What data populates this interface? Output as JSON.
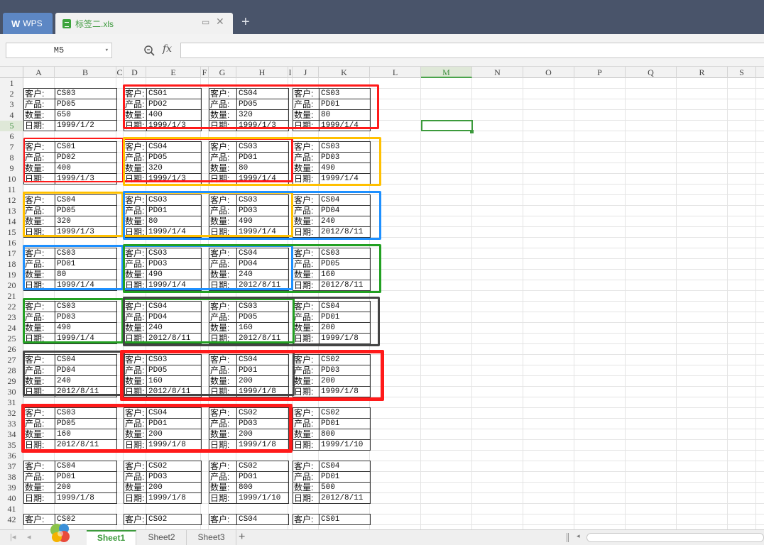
{
  "tabs": {
    "app_label": "WPS",
    "file_label": "标签二.xls"
  },
  "formula_bar": {
    "name_box": "M5",
    "fx_label": "fx",
    "formula": ""
  },
  "columns": [
    "A",
    "B",
    "C",
    "D",
    "E",
    "F",
    "G",
    "H",
    "I",
    "J",
    "K",
    "L",
    "M",
    "N",
    "O",
    "P",
    "Q",
    "R",
    "S"
  ],
  "active_column": "M",
  "rows": [
    "1",
    "2",
    "3",
    "4",
    "5",
    "6",
    "7",
    "8",
    "9",
    "10",
    "11",
    "12",
    "13",
    "14",
    "15",
    "16",
    "17",
    "18",
    "19",
    "20",
    "21",
    "22",
    "23",
    "24",
    "25",
    "26",
    "27",
    "28",
    "29",
    "30",
    "31",
    "32",
    "33",
    "34",
    "35",
    "36",
    "37",
    "38",
    "39",
    "40",
    "41",
    "42"
  ],
  "active_row": "5",
  "labels": [
    "客户:",
    "产品:",
    "数量:",
    "日期:"
  ],
  "cards": [
    [
      "CS03",
      "PD05",
      "650",
      "1999/1/2"
    ],
    [
      "CS01",
      "PD02",
      "400",
      "1999/1/3"
    ],
    [
      "CS04",
      "PD05",
      "320",
      "1999/1/3"
    ],
    [
      "CS03",
      "PD01",
      "80",
      "1999/1/4"
    ],
    [
      "CS01",
      "PD02",
      "400",
      "1999/1/3"
    ],
    [
      "CS04",
      "PD05",
      "320",
      "1999/1/3"
    ],
    [
      "CS03",
      "PD01",
      "80",
      "1999/1/4"
    ],
    [
      "CS03",
      "PD03",
      "490",
      "1999/1/4"
    ],
    [
      "CS04",
      "PD05",
      "320",
      "1999/1/3"
    ],
    [
      "CS03",
      "PD01",
      "80",
      "1999/1/4"
    ],
    [
      "CS03",
      "PD03",
      "490",
      "1999/1/4"
    ],
    [
      "CS04",
      "PD04",
      "240",
      "2012/8/11"
    ],
    [
      "CS03",
      "PD01",
      "80",
      "1999/1/4"
    ],
    [
      "CS03",
      "PD03",
      "490",
      "1999/1/4"
    ],
    [
      "CS04",
      "PD04",
      "240",
      "2012/8/11"
    ],
    [
      "CS03",
      "PD05",
      "160",
      "2012/8/11"
    ],
    [
      "CS03",
      "PD03",
      "490",
      "1999/1/4"
    ],
    [
      "CS04",
      "PD04",
      "240",
      "2012/8/11"
    ],
    [
      "CS03",
      "PD05",
      "160",
      "2012/8/11"
    ],
    [
      "CS04",
      "PD01",
      "200",
      "1999/1/8"
    ],
    [
      "CS04",
      "PD04",
      "240",
      "2012/8/11"
    ],
    [
      "CS03",
      "PD05",
      "160",
      "2012/8/11"
    ],
    [
      "CS04",
      "PD01",
      "200",
      "1999/1/8"
    ],
    [
      "CS02",
      "PD03",
      "200",
      "1999/1/8"
    ],
    [
      "CS03",
      "PD05",
      "160",
      "2012/8/11"
    ],
    [
      "CS04",
      "PD01",
      "200",
      "1999/1/8"
    ],
    [
      "CS02",
      "PD03",
      "200",
      "1999/1/8"
    ],
    [
      "CS02",
      "PD01",
      "800",
      "1999/1/10"
    ],
    [
      "CS04",
      "PD01",
      "200",
      "1999/1/8"
    ],
    [
      "CS02",
      "PD03",
      "200",
      "1999/1/8"
    ],
    [
      "CS02",
      "PD01",
      "800",
      "1999/1/10"
    ],
    [
      "CS04",
      "PD01",
      "500",
      "2012/8/11"
    ],
    [
      "CS02",
      "",
      "",
      ""
    ],
    [
      "CS02",
      "",
      "",
      ""
    ],
    [
      "CS04",
      "",
      "",
      ""
    ],
    [
      "CS01",
      "",
      "",
      ""
    ]
  ],
  "sheets": [
    "Sheet1",
    "Sheet2",
    "Sheet3"
  ],
  "active_sheet": "Sheet1",
  "highlight_colors": {
    "red": "#ff1a1a",
    "orange": "#ffc000",
    "blue": "#1e90ff",
    "green": "#22a022",
    "gray": "#444444"
  },
  "icons": [
    "wps-logo-icon",
    "spreadsheet-file-icon",
    "restore-window-icon",
    "close-icon",
    "plus-icon",
    "dropdown-arrow-icon",
    "zoom-icon",
    "fx-icon",
    "app-logo-icon"
  ]
}
